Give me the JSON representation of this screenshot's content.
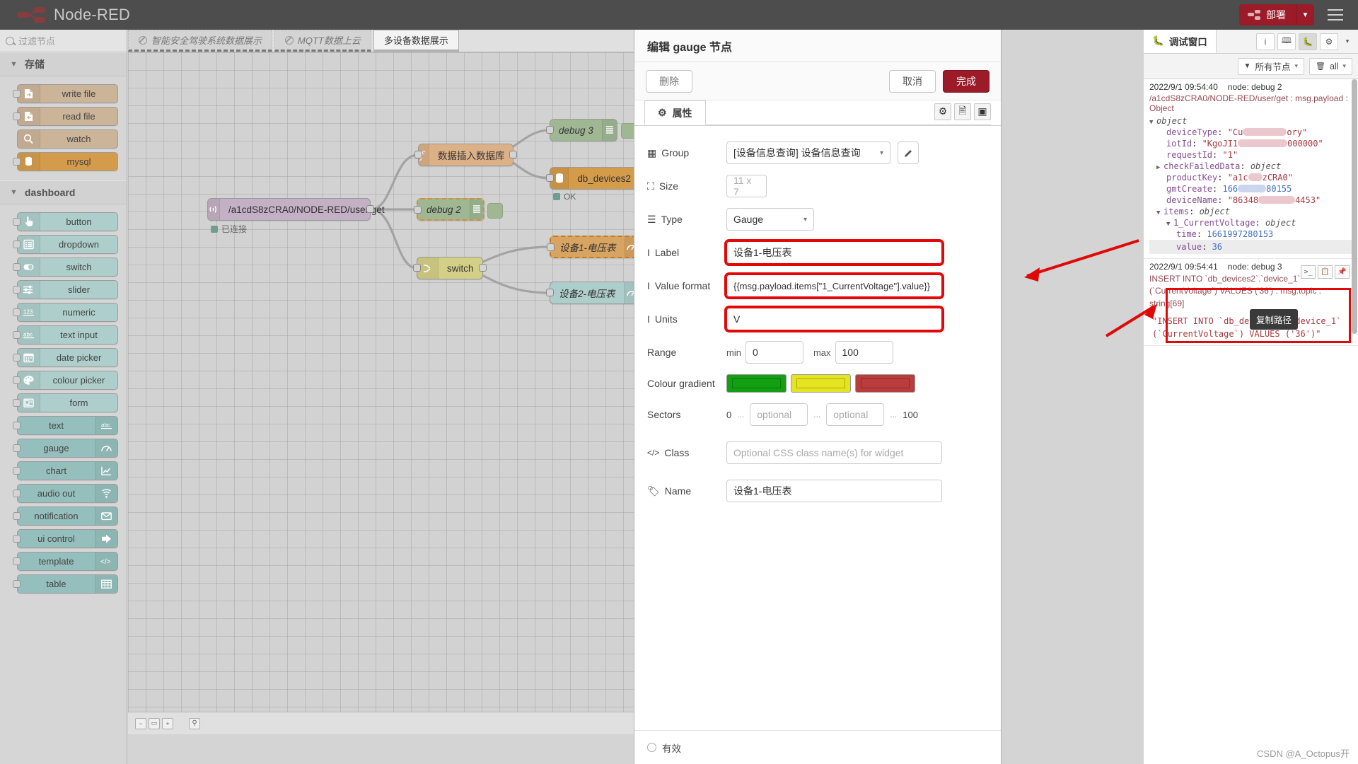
{
  "app": {
    "brand": "Node-RED",
    "deploy_label": "部署"
  },
  "palette": {
    "search_placeholder": "过滤节点",
    "categories": [
      {
        "name": "存储",
        "nodes": [
          {
            "label": "write file",
            "icon": "file-export-icon",
            "style": "storage",
            "icon_side": "left"
          },
          {
            "label": "read file",
            "icon": "file-import-icon",
            "style": "storage",
            "icon_side": "left"
          },
          {
            "label": "watch",
            "icon": "magnifier-icon",
            "style": "storage",
            "icon_side": "left",
            "no_port": true
          },
          {
            "label": "mysql",
            "icon": "database-icon",
            "style": "mysql",
            "icon_side": "left"
          }
        ]
      },
      {
        "name": "dashboard",
        "nodes": [
          {
            "label": "button",
            "icon": "hand-pointer-icon",
            "style": "dash",
            "icon_side": "left"
          },
          {
            "label": "dropdown",
            "icon": "list-icon",
            "style": "dash",
            "icon_side": "left"
          },
          {
            "label": "switch",
            "icon": "toggle-icon",
            "style": "dash",
            "icon_side": "left"
          },
          {
            "label": "slider",
            "icon": "sliders-icon",
            "style": "dash",
            "icon_side": "left"
          },
          {
            "label": "numeric",
            "icon": "123-icon",
            "style": "dash",
            "icon_side": "left"
          },
          {
            "label": "text input",
            "icon": "abc-icon",
            "style": "dash",
            "icon_side": "left"
          },
          {
            "label": "date picker",
            "icon": "calendar-icon",
            "style": "dash",
            "icon_side": "left"
          },
          {
            "label": "colour picker",
            "icon": "palette-icon",
            "style": "dash",
            "icon_side": "left"
          },
          {
            "label": "form",
            "icon": "form-icon",
            "style": "dash",
            "icon_side": "left"
          },
          {
            "label": "text",
            "icon": "abc-icon",
            "style": "dash2",
            "icon_side": "right"
          },
          {
            "label": "gauge",
            "icon": "gauge-icon",
            "style": "dash2",
            "icon_side": "right"
          },
          {
            "label": "chart",
            "icon": "chart-line-icon",
            "style": "dash2",
            "icon_side": "right"
          },
          {
            "label": "audio out",
            "icon": "audio-wave-icon",
            "style": "dash2",
            "icon_side": "right"
          },
          {
            "label": "notification",
            "icon": "envelope-icon",
            "style": "dash2",
            "icon_side": "right"
          },
          {
            "label": "ui control",
            "icon": "arrow-right-icon",
            "style": "dash2",
            "icon_side": "right"
          },
          {
            "label": "template",
            "icon": "code-icon",
            "style": "dash2",
            "icon_side": "right"
          },
          {
            "label": "table",
            "icon": "table-icon",
            "style": "dash2",
            "icon_side": "right"
          }
        ]
      }
    ]
  },
  "flow": {
    "tabs": [
      {
        "label": "智能安全驾驶系统数据展示",
        "disabled": true,
        "active": false
      },
      {
        "label": "MQTT数据上云",
        "disabled": true,
        "active": false
      },
      {
        "label": "多设备数据展示",
        "disabled": false,
        "active": true
      }
    ],
    "nodes": [
      {
        "label": "/a1cdS8zCRA0/NODE-RED/user/get",
        "status": "已连接",
        "type": "mqtt-in"
      },
      {
        "label": "数据插入数据库",
        "type": "function"
      },
      {
        "label": "debug 2",
        "type": "debug",
        "selected": true
      },
      {
        "label": "debug 3",
        "type": "debug"
      },
      {
        "label": "db_devices2",
        "status": "OK",
        "type": "mysql"
      },
      {
        "label": "switch",
        "type": "switch"
      },
      {
        "label": "设备1-电压表",
        "type": "gauge-selected"
      },
      {
        "label": "设备2-电压表",
        "type": "gauge"
      }
    ]
  },
  "edit_panel": {
    "title": "编辑 gauge 节点",
    "delete_label": "删除",
    "cancel_label": "取消",
    "done_label": "完成",
    "tab_properties": "属性",
    "footer_enabled": "有效",
    "fields": {
      "group_label": "Group",
      "group_value": "[设备信息查询] 设备信息查询",
      "size_label": "Size",
      "size_value": "11 x 7",
      "type_label": "Type",
      "type_value": "Gauge",
      "label_label": "Label",
      "label_value": "设备1-电压表",
      "value_format_label": "Value format",
      "value_format_value": "{{msg.payload.items[\"1_CurrentVoltage\"].value}}",
      "units_label": "Units",
      "units_value": "V",
      "range_label": "Range",
      "range_min_prefix": "min",
      "range_min_value": "0",
      "range_max_prefix": "max",
      "range_max_value": "100",
      "gradient_label": "Colour gradient",
      "gradient_colors": [
        "#00a600",
        "#e6e600",
        "#ca3838"
      ],
      "sectors_label": "Sectors",
      "sectors_start": "0",
      "sectors_sep": "...",
      "sectors_opt1": "optional",
      "sectors_opt2": "optional",
      "sectors_end": "100",
      "class_label": "Class",
      "class_placeholder": "Optional CSS class name(s) for widget",
      "name_label": "Name",
      "name_value": "设备1-电压表"
    }
  },
  "debug": {
    "tab_label": "调试窗口",
    "filter_nodes_label": "所有节点",
    "clear_label": "all",
    "tooltip": "复制路径",
    "messages": [
      {
        "time": "2022/9/1 09:54:40",
        "node": "node: debug 2",
        "topic": "/a1cdS8zCRA0/NODE-RED/user/get : msg.payload : Object",
        "root": "object",
        "rows": [
          {
            "indent": 1,
            "key": "deviceType",
            "value": "\"Cu",
            "value_suffix": "ory\"",
            "kind": "string",
            "redact": "pink",
            "redact_w": 62
          },
          {
            "indent": 1,
            "key": "iotId",
            "value": "\"KgoJI1",
            "value_suffix": "000000\"",
            "kind": "string",
            "redact": "pink",
            "redact_w": 70
          },
          {
            "indent": 1,
            "key": "requestId",
            "value": "\"1\"",
            "kind": "string"
          },
          {
            "indent": 0,
            "key": "checkFailedData",
            "value": "object",
            "kind": "type",
            "collapsed": true
          },
          {
            "indent": 1,
            "key": "productKey",
            "value": "\"a1c",
            "value_suffix": "zCRA0\"",
            "kind": "string",
            "redact": "pink",
            "redact_w": 20
          },
          {
            "indent": 1,
            "key": "gmtCreate",
            "value": "166",
            "value_suffix": "80155",
            "kind": "number",
            "redact": "blue",
            "redact_w": 40
          },
          {
            "indent": 1,
            "key": "deviceName",
            "value": "\"86348",
            "value_suffix": "4453\"",
            "kind": "string",
            "redact": "pink",
            "redact_w": 52
          },
          {
            "indent": 0,
            "key": "items",
            "value": "object",
            "kind": "type",
            "expanded": true
          },
          {
            "indent": 1,
            "key": "1_CurrentVoltage",
            "value": "object",
            "kind": "type",
            "expanded": true
          },
          {
            "indent": 2,
            "key": "time",
            "value": "1661997280153",
            "kind": "number"
          },
          {
            "indent": 2,
            "key": "value",
            "value": "36",
            "kind": "number",
            "highlighted": true
          }
        ]
      },
      {
        "time": "2022/9/1 09:54:41",
        "node": "node: debug 3",
        "topic": "INSERT INTO `db_devices2`.`device_1` (`CurrentVoltage`) VALUES ('36') : msg.topic : string[69]",
        "body": "\"INSERT INTO `db_devices2`.`device_1` (`CurrentVoltage`) VALUES ('36')\""
      }
    ]
  },
  "watermark": "CSDN @A_Octopus开"
}
